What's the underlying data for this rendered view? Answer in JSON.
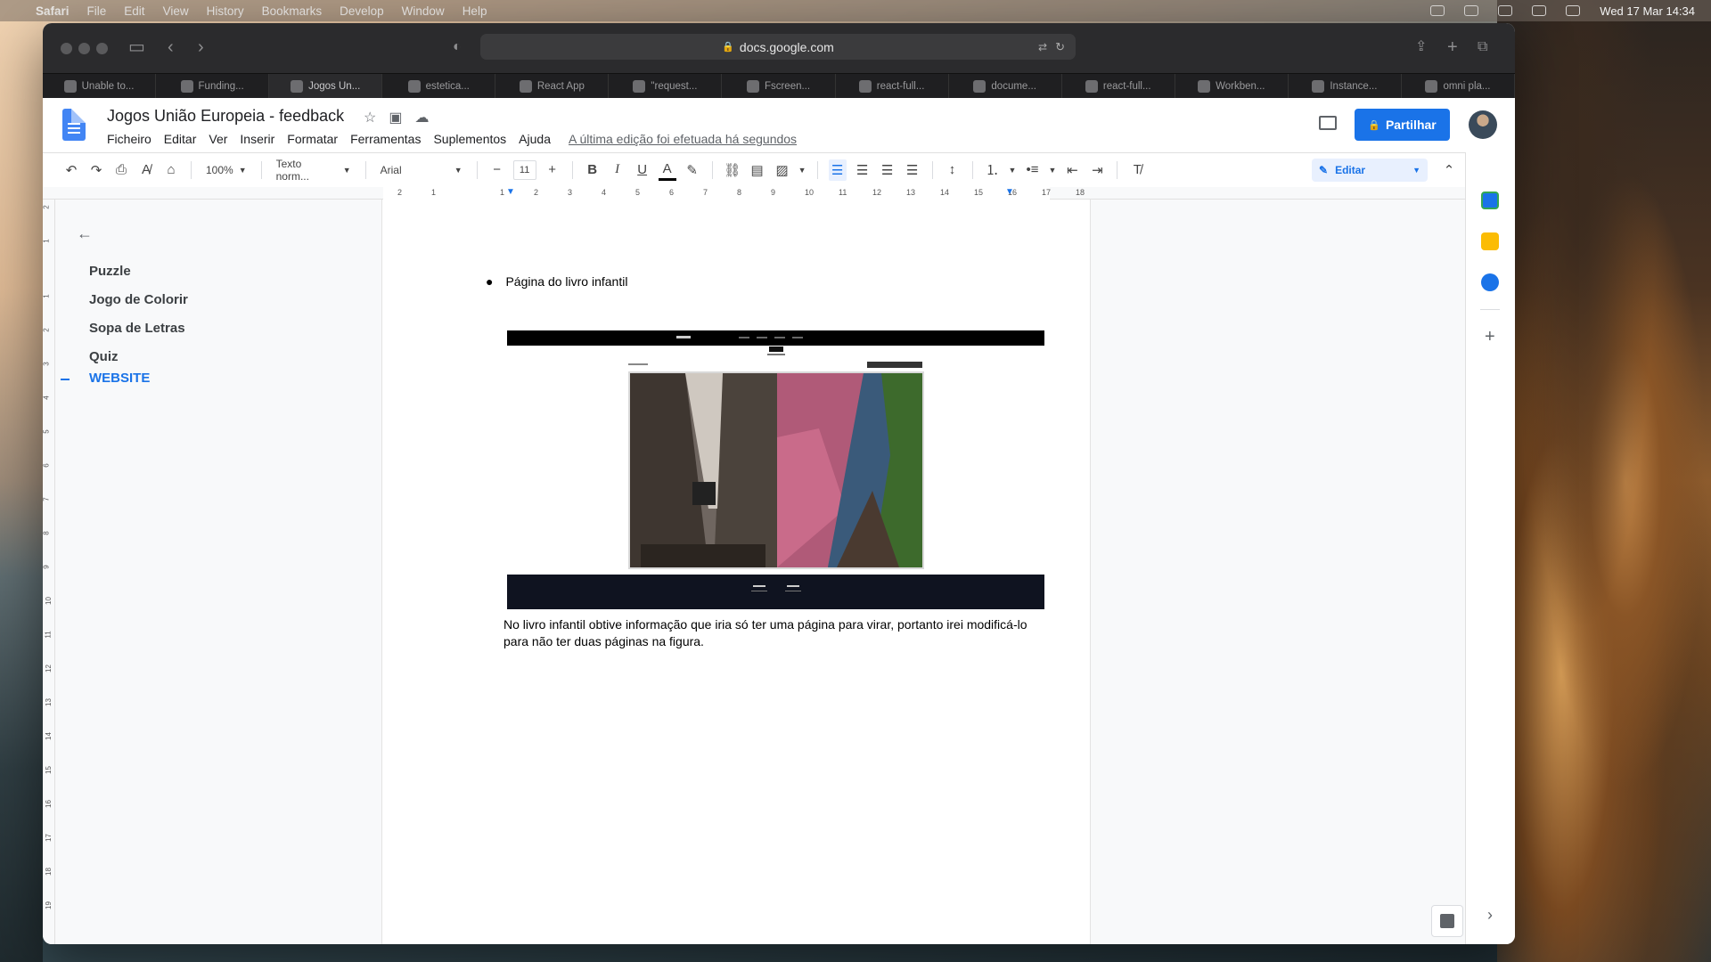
{
  "menubar": {
    "items": [
      "Safari",
      "File",
      "Edit",
      "View",
      "History",
      "Bookmarks",
      "Develop",
      "Window",
      "Help"
    ],
    "clock": "Wed 17 Mar  14:34"
  },
  "browser": {
    "url": "docs.google.com",
    "tabs": [
      {
        "label": "Unable to..."
      },
      {
        "label": "Funding..."
      },
      {
        "label": "Jogos Un..."
      },
      {
        "label": "estetica..."
      },
      {
        "label": "React App"
      },
      {
        "label": "\"request..."
      },
      {
        "label": "Fscreen..."
      },
      {
        "label": "react-full..."
      },
      {
        "label": "docume..."
      },
      {
        "label": "react-full..."
      },
      {
        "label": "Workben..."
      },
      {
        "label": "Instance..."
      },
      {
        "label": "omni pla..."
      }
    ]
  },
  "doc": {
    "title": "Jogos União Europeia - feedback",
    "menu": [
      "Ficheiro",
      "Editar",
      "Ver",
      "Inserir",
      "Formatar",
      "Ferramentas",
      "Suplementos",
      "Ajuda"
    ],
    "last_edit": "A última edição foi efetuada há segundos",
    "share_label": "Partilhar"
  },
  "toolbar": {
    "zoom": "100%",
    "style": "Texto norm...",
    "font": "Arial",
    "font_size": "11",
    "mode": "Editar"
  },
  "outline": {
    "items": [
      "Puzzle",
      "Jogo de Colorir",
      "Sopa de Letras",
      "Quiz",
      "WEBSITE"
    ]
  },
  "content": {
    "bullet": "Página do livro infantil",
    "paragraph": "No livro infantil obtive informação que iria só ter uma página para virar, portanto irei modificá-lo para não ter duas páginas na figura."
  },
  "ruler": {
    "h": [
      "2",
      "1",
      "1",
      "2",
      "3",
      "4",
      "5",
      "6",
      "7",
      "8",
      "9",
      "10",
      "11",
      "12",
      "13",
      "14",
      "15",
      "16",
      "17",
      "18"
    ],
    "v": [
      "2",
      "1",
      "1",
      "2",
      "3",
      "4",
      "5",
      "6",
      "7",
      "8",
      "9",
      "10",
      "11",
      "12",
      "13",
      "14",
      "15",
      "16",
      "17",
      "18",
      "19"
    ]
  },
  "colors": {
    "accent": "#1a73e8",
    "chrome_dark": "#2b2b2d"
  }
}
